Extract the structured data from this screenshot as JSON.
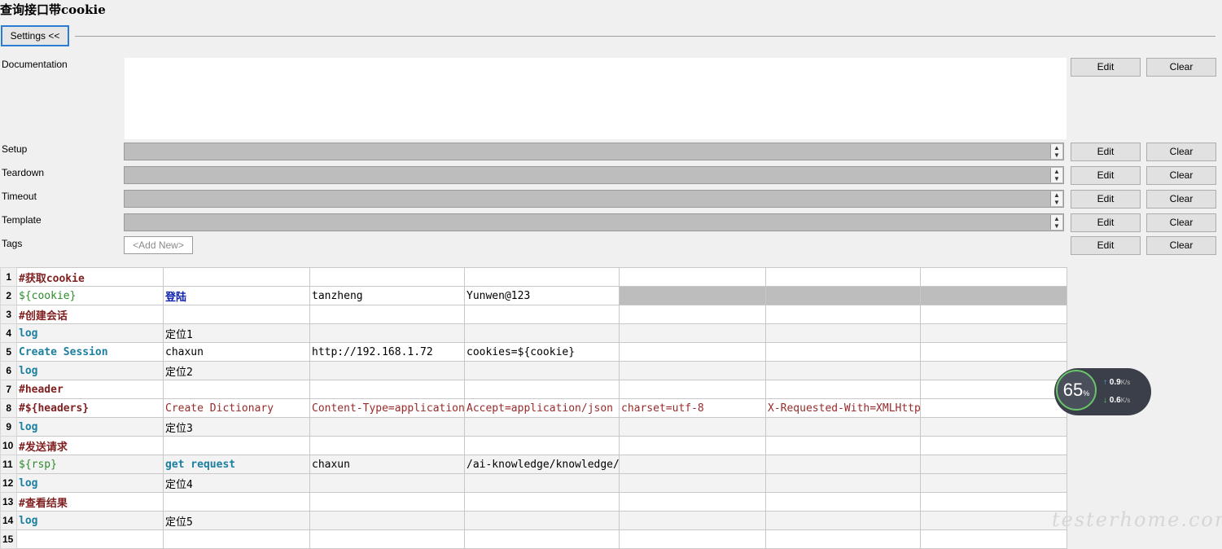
{
  "page": {
    "title": "查询接口带cookie"
  },
  "settings": {
    "toggle_label": "Settings <<"
  },
  "fields": {
    "documentation": "Documentation",
    "setup": "Setup",
    "teardown": "Teardown",
    "timeout": "Timeout",
    "template": "Template",
    "tags": "Tags"
  },
  "buttons": {
    "edit": "Edit",
    "clear": "Clear"
  },
  "tags": {
    "add_new": "<Add New>"
  },
  "grid": {
    "rows": [
      {
        "n": "1",
        "cells": [
          "#获取cookie",
          "",
          "",
          "",
          "",
          "",
          ""
        ]
      },
      {
        "n": "2",
        "cells": [
          "${cookie}",
          "登陆",
          "tanzheng",
          "Yunwen@123",
          "",
          "",
          ""
        ]
      },
      {
        "n": "3",
        "cells": [
          "#创建会话",
          "",
          "",
          "",
          "",
          "",
          ""
        ]
      },
      {
        "n": "4",
        "cells": [
          "log",
          "定位1",
          "",
          "",
          "",
          "",
          ""
        ]
      },
      {
        "n": "5",
        "cells": [
          "Create Session",
          "chaxun",
          "http://192.168.1.72",
          "cookies=${cookie}",
          "",
          "",
          ""
        ]
      },
      {
        "n": "6",
        "cells": [
          "log",
          "定位2",
          "",
          "",
          "",
          "",
          ""
        ]
      },
      {
        "n": "7",
        "cells": [
          "#header",
          "",
          "",
          "",
          "",
          "",
          ""
        ]
      },
      {
        "n": "8",
        "cells": [
          "#${headers}",
          "Create Dictionary",
          "Content-Type=application",
          "Accept=application/json",
          "charset=utf-8",
          "X-Requested-With=XMLHttp",
          ""
        ]
      },
      {
        "n": "9",
        "cells": [
          "log",
          "定位3",
          "",
          "",
          "",
          "",
          ""
        ]
      },
      {
        "n": "10",
        "cells": [
          "#发送请求",
          "",
          "",
          "",
          "",
          "",
          ""
        ]
      },
      {
        "n": "11",
        "cells": [
          "${rsp}",
          "get request",
          "chaxun",
          "/ai-knowledge/knowledge/",
          "",
          "",
          ""
        ]
      },
      {
        "n": "12",
        "cells": [
          "log",
          "定位4",
          "",
          "",
          "",
          "",
          ""
        ]
      },
      {
        "n": "13",
        "cells": [
          "#查看结果",
          "",
          "",
          "",
          "",
          "",
          ""
        ]
      },
      {
        "n": "14",
        "cells": [
          "log",
          "定位5",
          "",
          "",
          "",
          "",
          ""
        ]
      },
      {
        "n": "15",
        "cells": [
          "",
          "",
          "",
          "",
          "",
          "",
          ""
        ]
      }
    ]
  },
  "network_widget": {
    "percent": "65",
    "percent_unit": "%",
    "up": "0.9",
    "down": "0.6",
    "unit": "K/s"
  },
  "watermark": "testerhome.com"
}
